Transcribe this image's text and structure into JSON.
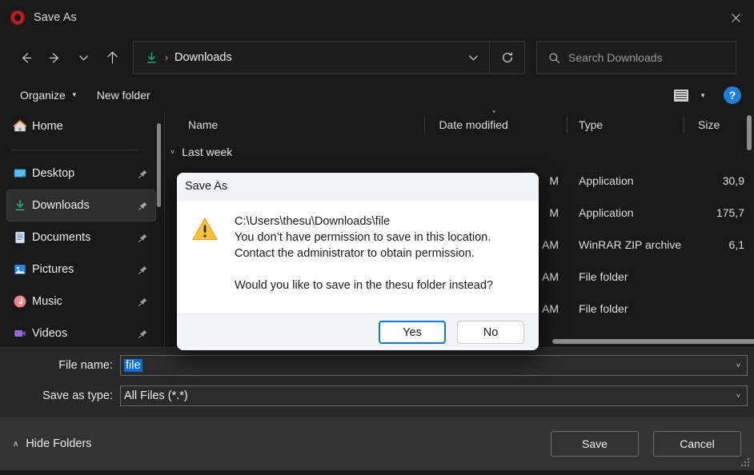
{
  "window": {
    "title": "Save As",
    "app_icon": "opera-logo",
    "close_icon": "close-icon"
  },
  "nav": {
    "back_icon": "arrow-left-icon",
    "forward_icon": "arrow-right-icon",
    "recent_icon": "chevron-down-icon",
    "up_icon": "arrow-up-icon",
    "breadcrumb": {
      "folder_icon": "downloads-icon",
      "separator": "›",
      "label": "Downloads"
    },
    "address_chevron_icon": "chevron-down-icon",
    "refresh_icon": "refresh-icon"
  },
  "search": {
    "icon": "search-icon",
    "placeholder": "Search Downloads",
    "value": ""
  },
  "command_bar": {
    "organize_label": "Organize",
    "organize_caret": "▼",
    "new_folder_label": "New folder",
    "view_icon": "list-view-icon",
    "view_caret": "▼",
    "help_icon": "help-icon",
    "help_label": "?"
  },
  "sidebar": {
    "items": [
      {
        "label": "Home",
        "icon": "home-icon",
        "pinned": false,
        "selected": false
      },
      {
        "label": "Desktop",
        "icon": "desktop-icon",
        "pinned": true,
        "selected": false
      },
      {
        "label": "Downloads",
        "icon": "downloads-icon",
        "pinned": true,
        "selected": true
      },
      {
        "label": "Documents",
        "icon": "documents-icon",
        "pinned": true,
        "selected": false
      },
      {
        "label": "Pictures",
        "icon": "pictures-icon",
        "pinned": true,
        "selected": false
      },
      {
        "label": "Music",
        "icon": "music-icon",
        "pinned": true,
        "selected": false
      },
      {
        "label": "Videos",
        "icon": "videos-icon",
        "pinned": true,
        "selected": false
      }
    ],
    "pin_icon": "pin-icon"
  },
  "file_list": {
    "columns": [
      "Name",
      "Date modified",
      "Type",
      "Size"
    ],
    "sort_indicator_icon": "chevron-down-icon",
    "group": {
      "label": "Last week",
      "chevron_icon": "chevron-down-icon"
    },
    "rows": [
      {
        "name": "",
        "date": "M",
        "type": "Application",
        "size": "30,9"
      },
      {
        "name": "",
        "date": "M",
        "type": "Application",
        "size": "175,7"
      },
      {
        "name": "",
        "date": "AM",
        "type": "WinRAR ZIP archive",
        "size": "6,1"
      },
      {
        "name": "",
        "date": "AM",
        "type": "File folder",
        "size": ""
      },
      {
        "name": "",
        "date": "AM",
        "type": "File folder",
        "size": ""
      }
    ]
  },
  "form": {
    "file_name_label": "File name:",
    "file_name_value": "file",
    "file_name_chevron_icon": "chevron-down-icon",
    "save_as_type_label": "Save as type:",
    "save_as_type_value": "All Files (*.*)",
    "save_as_type_chevron_icon": "chevron-down-icon"
  },
  "footer": {
    "hide_folders_label": "Hide Folders",
    "hide_folders_chevron": "∧",
    "save_label": "Save",
    "cancel_label": "Cancel",
    "resize_grip_icon": "resize-grip-icon"
  },
  "dialog": {
    "title": "Save As",
    "warning_icon": "warning-triangle-icon",
    "path_line": "C:\\Users\\thesu\\Downloads\\file",
    "message_line_1": "You don’t have permission to save in this location.",
    "message_line_2": "Contact the administrator to obtain permission.",
    "question_line": "Would you like to save in the thesu folder instead?",
    "yes_label": "Yes",
    "no_label": "No"
  },
  "colors": {
    "window_bg": "#191919",
    "footer_bg": "#333333",
    "accent_blue": "#0a6cd4",
    "focus_blue": "#1679c8",
    "warning_yellow": "#f5c335",
    "downloads_green": "#19b288",
    "opera_red": "#d62222"
  }
}
